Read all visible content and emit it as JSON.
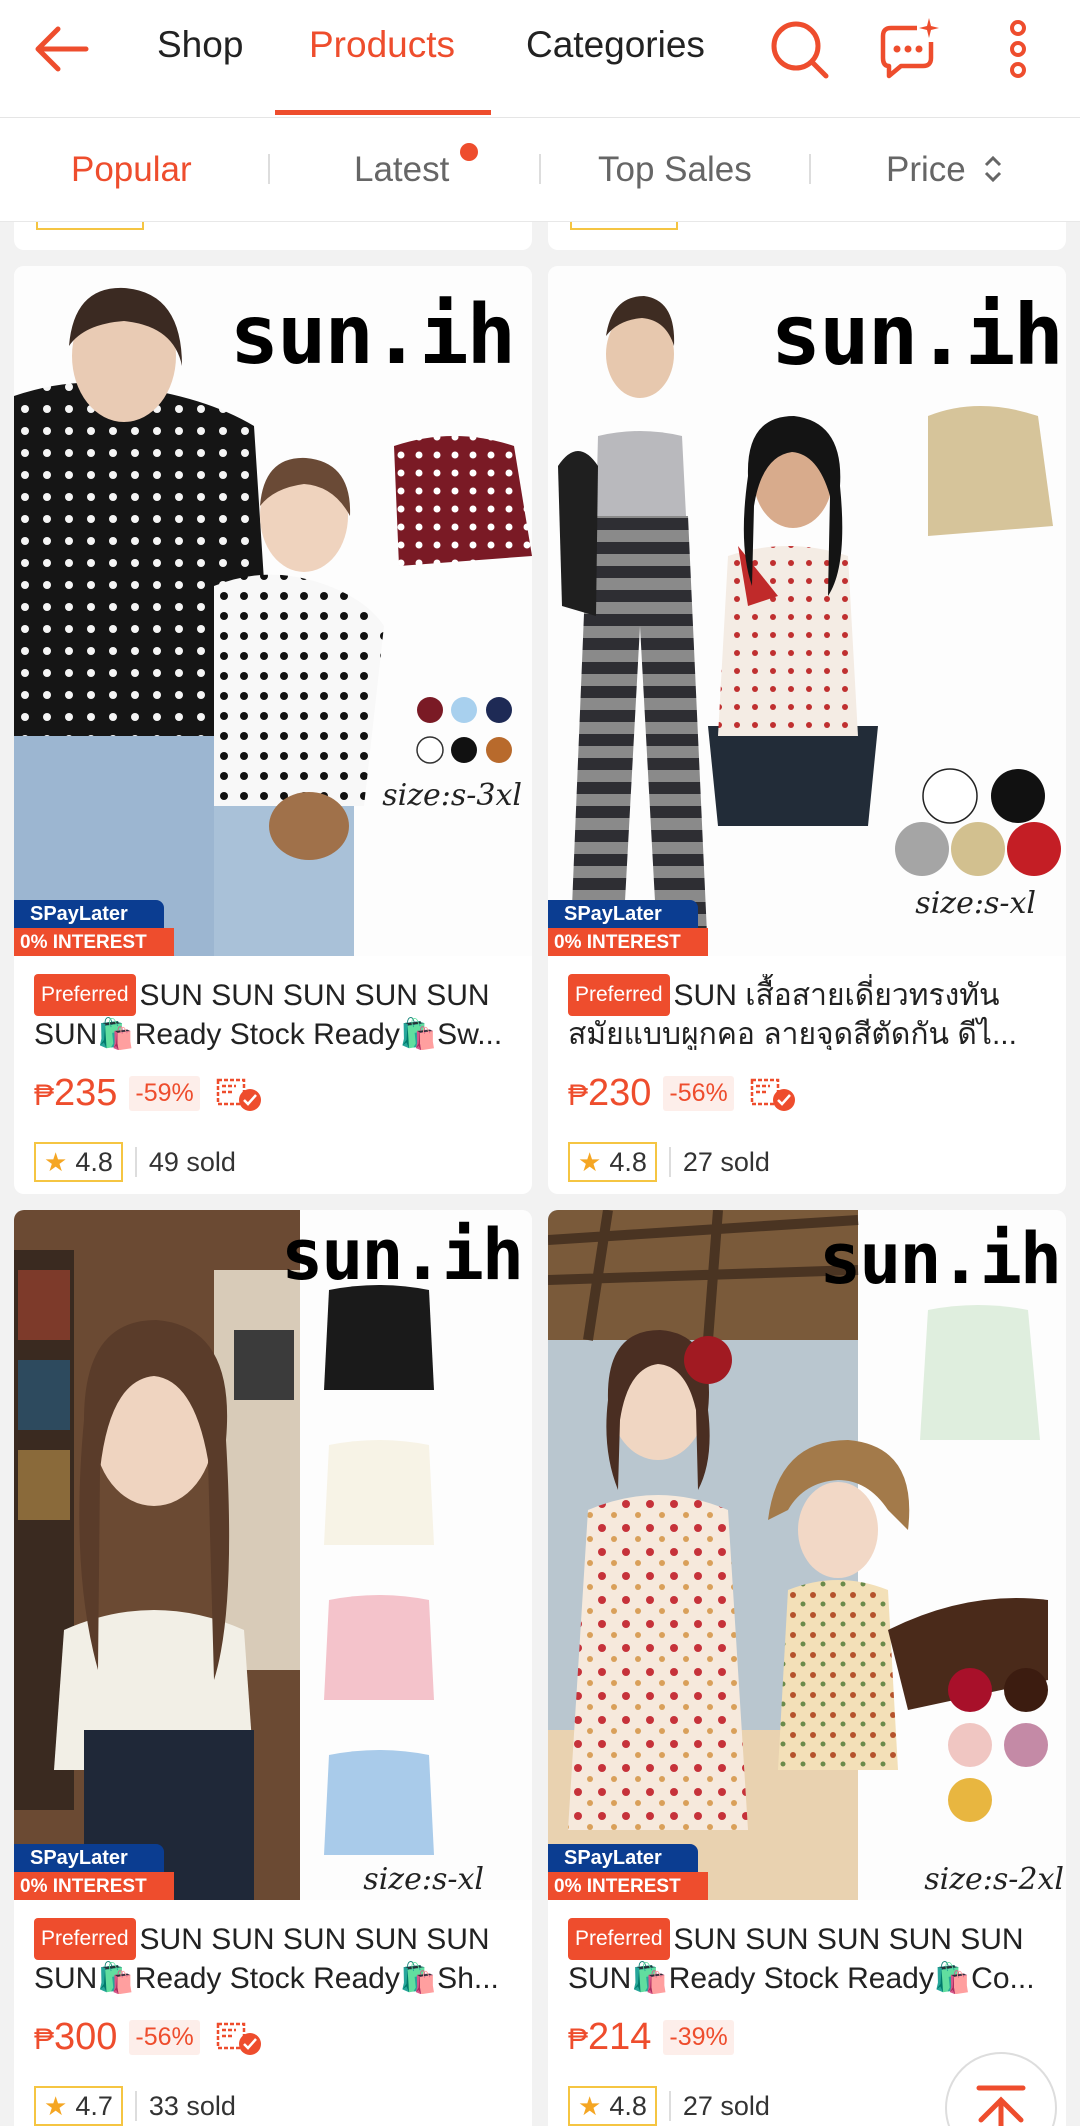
{
  "nav": {
    "tabs": [
      "Shop",
      "Products",
      "Categories"
    ],
    "active_tab": "Products"
  },
  "sort": {
    "options": [
      "Popular",
      "Latest",
      "Top Sales",
      "Price"
    ],
    "active": "Popular"
  },
  "theme": {
    "accent": "#ee4d2d",
    "rating_border": "#f5c542"
  },
  "badge_labels": {
    "spay_top": "SPayLater",
    "spay_bottom": "0% INTEREST",
    "preferred": "Preferred"
  },
  "products": [
    {
      "brand": "sun.ih",
      "size_text": "size:s-3xl",
      "title": "SUN SUN SUN SUN SUN SUN🛍️Ready Stock Ready🛍️Sw...",
      "currency": "₱",
      "price": "235",
      "discount": "-59%",
      "rating": "4.8",
      "sold": "49 sold"
    },
    {
      "brand": "sun.ih",
      "size_text": "size:s-xl",
      "title": "SUN  เสื้อสายเดี่ยวทรงทันสมัยแบบผูกคอ ลายจุดสีตัดกัน ดีไ...",
      "currency": "₱",
      "price": "230",
      "discount": "-56%",
      "rating": "4.8",
      "sold": "27 sold"
    },
    {
      "brand": "sun.ih",
      "size_text": "size:s-xl",
      "title": "SUN SUN SUN SUN SUN SUN🛍️Ready Stock Ready🛍️Sh...",
      "currency": "₱",
      "price": "300",
      "discount": "-56%",
      "rating": "4.7",
      "sold": "33 sold"
    },
    {
      "brand": "sun.ih",
      "size_text": "size:s-2xl",
      "title": "SUN SUN SUN SUN SUN SUN🛍️Ready Stock Ready🛍️Co...",
      "currency": "₱",
      "price": "214",
      "discount": "-39%",
      "rating": "4.8",
      "sold": "27 sold"
    }
  ]
}
